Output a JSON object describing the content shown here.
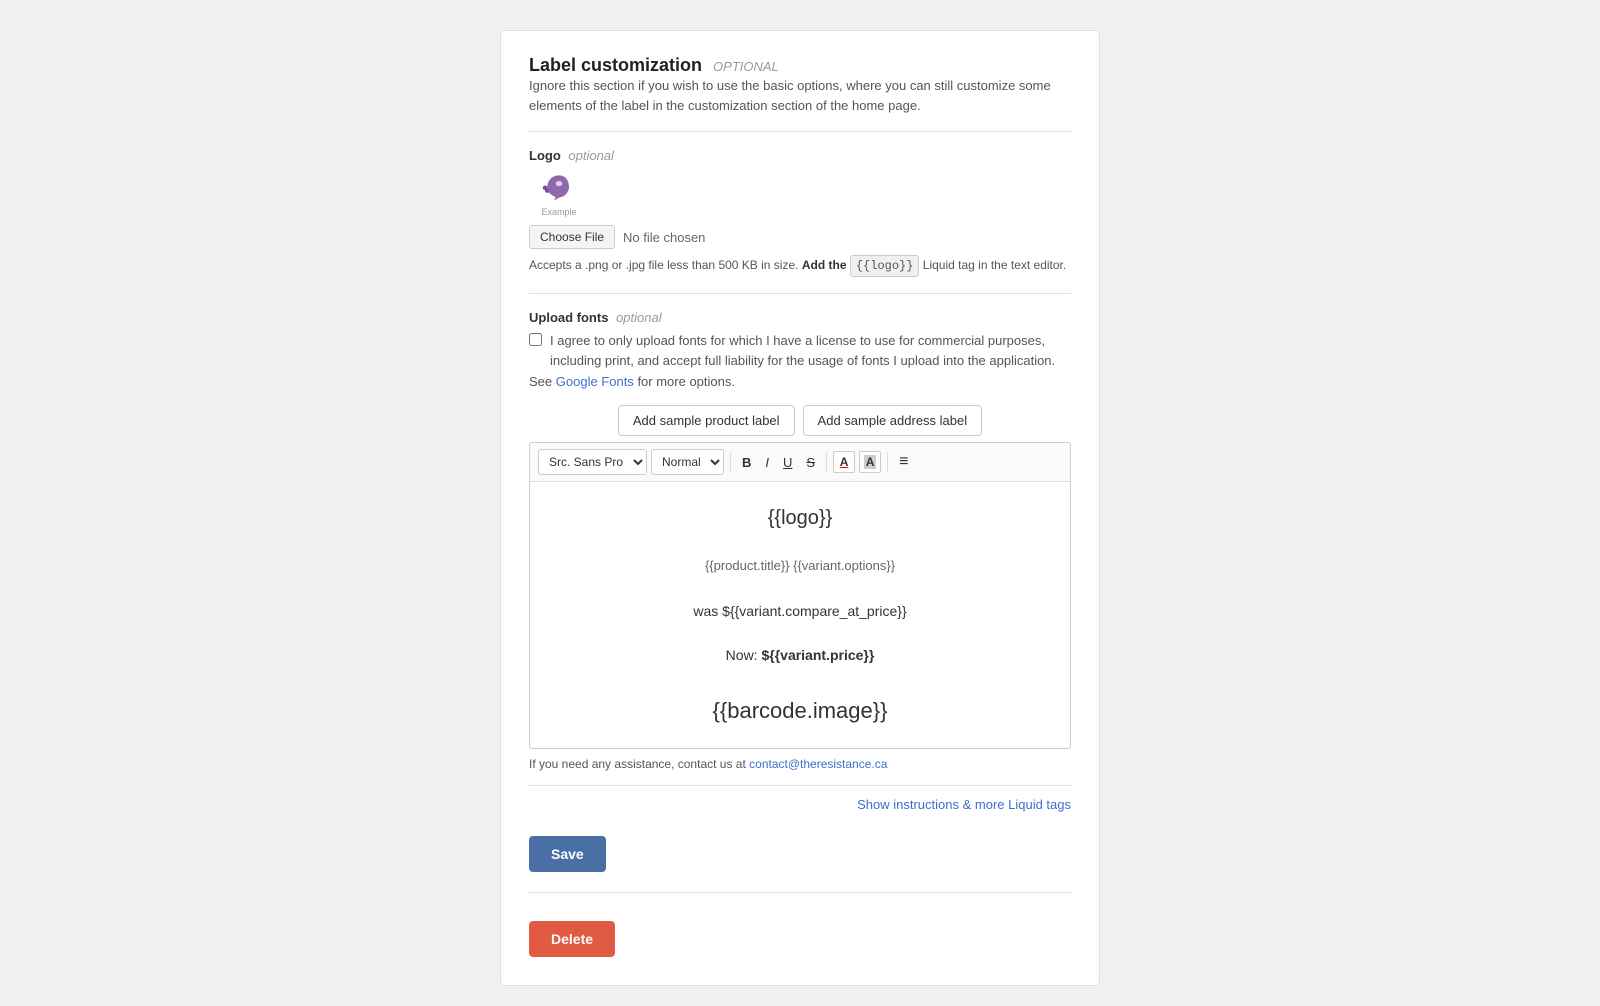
{
  "page": {
    "section_title": "Label customization",
    "section_title_optional": "OPTIONAL",
    "section_desc": "Ignore this section if you wish to use the basic options, where you can still customize some elements of the label in the customization section of the home page.",
    "logo": {
      "label": "Logo",
      "label_optional": "optional",
      "example_text": "Example",
      "choose_file_label": "Choose File",
      "no_file_text": "No file chosen",
      "file_hint_prefix": "Accepts a .png or .jpg file less than 500 KB in size.",
      "file_hint_bold": "Add the",
      "liquid_tag": "{{logo}}",
      "file_hint_suffix": "Liquid tag in the text editor."
    },
    "upload_fonts": {
      "label": "Upload fonts",
      "label_optional": "optional",
      "checkbox_label": "I agree to only upload fonts for which I have a license to use for commercial purposes, including print, and accept full liability for the usage of fonts I upload into the application.",
      "see_text": "See",
      "google_fonts_link_text": "Google Fonts",
      "google_fonts_link_href": "#",
      "more_options_text": "for more options."
    },
    "editor": {
      "btn_add_sample_product": "Add sample product label",
      "btn_add_sample_address": "Add sample address label",
      "font_select_value": "Src. Sans Pro",
      "size_select_value": "Normal",
      "toolbar": {
        "bold": "B",
        "italic": "I",
        "underline": "U",
        "strikethrough": "S",
        "font_color": "A",
        "highlight": "A",
        "align": "≡"
      },
      "content": {
        "line1": "{{logo}}",
        "line2": "{{product.title}} {{variant.options}}",
        "line3": "was ${{variant.compare_at_price}}",
        "line4_prefix": "Now: ",
        "line4_bold": "${{variant.price}}",
        "line5": "{{barcode.image}}"
      },
      "assist_text_prefix": "If you need any assistance, contact us at",
      "assist_link_text": "contact@theresistance.ca",
      "assist_link_href": "mailto:contact@theresistance.ca",
      "instructions_link": "Show instructions & more Liquid tags"
    },
    "save_button": "Save",
    "delete_button": "Delete"
  }
}
